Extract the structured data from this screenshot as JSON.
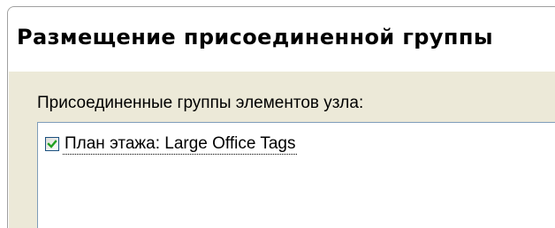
{
  "dialog": {
    "title": "Размещение присоединенной группы"
  },
  "list": {
    "label": "Присоединенные группы элементов узла:",
    "items": [
      {
        "label": "План этажа: Large Office Tags",
        "checked": true
      }
    ]
  },
  "colors": {
    "dialog_background": "#ece9d8",
    "title_background": "#ffffff",
    "list_border": "#7f9db9",
    "checkmark": "#21a121"
  }
}
